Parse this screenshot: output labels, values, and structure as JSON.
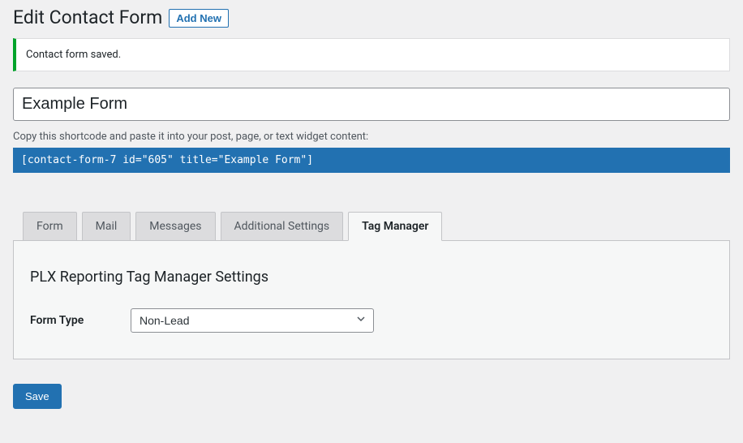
{
  "header": {
    "title": "Edit Contact Form",
    "add_new": "Add New"
  },
  "notice": {
    "message": "Contact form saved."
  },
  "form_title": "Example Form",
  "shortcode": {
    "label": "Copy this shortcode and paste it into your post, page, or text widget content:",
    "value": "[contact-form-7 id=\"605\" title=\"Example Form\"]"
  },
  "tabs": {
    "form": "Form",
    "mail": "Mail",
    "messages": "Messages",
    "additional": "Additional Settings",
    "tag_manager": "Tag Manager"
  },
  "panel": {
    "heading": "PLX Reporting Tag Manager Settings",
    "form_type_label": "Form Type",
    "form_type_value": "Non-Lead"
  },
  "actions": {
    "save": "Save"
  }
}
